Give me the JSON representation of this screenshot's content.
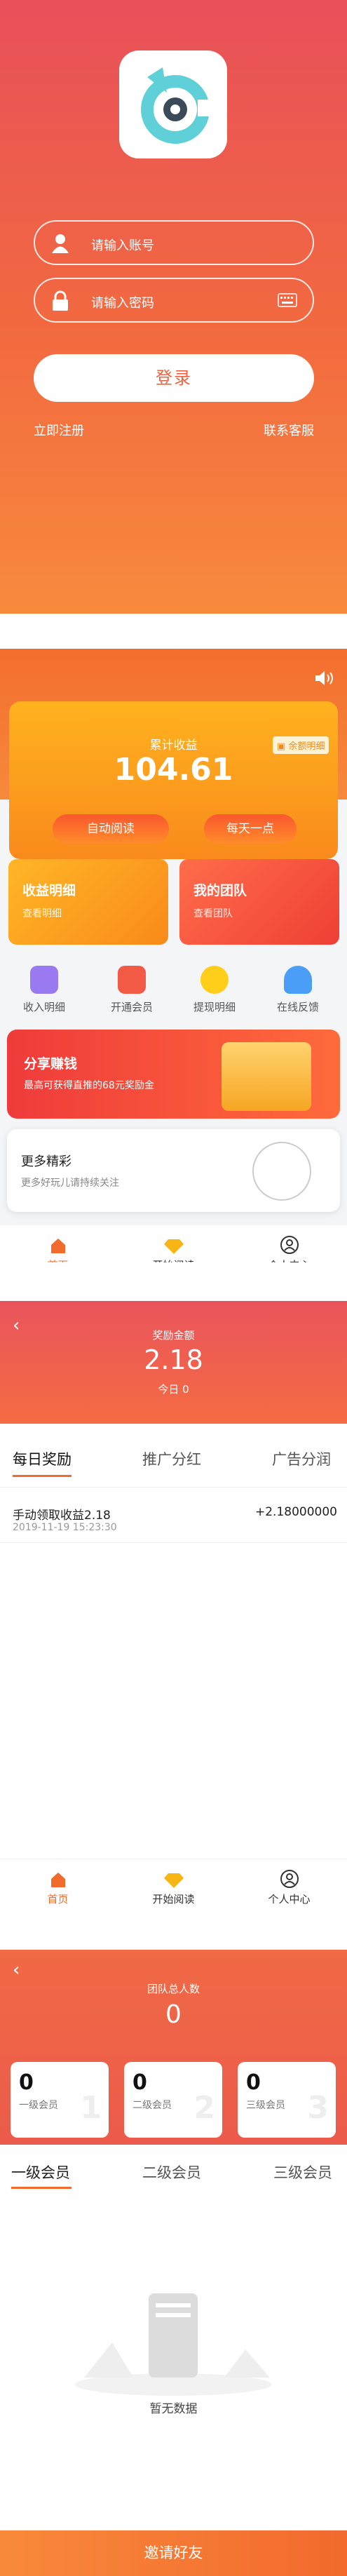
{
  "login": {
    "account_placeholder": "请输入账号",
    "password_placeholder": "请输入密码",
    "login_button": "登录",
    "register_link": "立即注册",
    "service_link": "联系客服"
  },
  "home": {
    "balance_detail_badge": "余额明细",
    "total_income_label": "累计收益",
    "total_income_value": "104.61",
    "auto_read_button": "自动阅读",
    "daily_more_button": "每天一点",
    "income_card": {
      "title": "收益明细",
      "sub": "查看明细"
    },
    "team_card": {
      "title": "我的团队",
      "sub": "查看团队"
    },
    "grid": [
      "收入明细",
      "开通会员",
      "提现明细",
      "在线反馈"
    ],
    "share": {
      "title": "分享赚钱",
      "sub": "最高可获得直推的68元奖励金"
    },
    "more": {
      "title": "更多精彩",
      "sub": "更多好玩儿请持续关注"
    }
  },
  "tabbar": [
    "首页",
    "开始阅读",
    "个人中心"
  ],
  "rewards": {
    "reward_amount_label": "奖励金额",
    "reward_amount_value": "2.18",
    "today_label": "今日 0",
    "tabs": [
      "每日奖励",
      "推广分红",
      "广告分润"
    ],
    "records": [
      {
        "title": "手动领取收益2.18",
        "time": "2019-11-19 15:23:30",
        "amount": "+2.18000000"
      }
    ]
  },
  "team": {
    "total_label": "团队总人数",
    "total_value": "0",
    "levels": [
      {
        "count": "0",
        "label": "一级会员",
        "mark": "1"
      },
      {
        "count": "0",
        "label": "二级会员",
        "mark": "2"
      },
      {
        "count": "0",
        "label": "三级会员",
        "mark": "3"
      }
    ],
    "tabs": [
      "一级会员",
      "二级会员",
      "三级会员"
    ],
    "empty_text": "暂无数据",
    "invite_button": "邀请好友"
  },
  "colors": {
    "accent": "#f06b2c",
    "red": "#e9545c",
    "orange": "#f98a1c"
  }
}
